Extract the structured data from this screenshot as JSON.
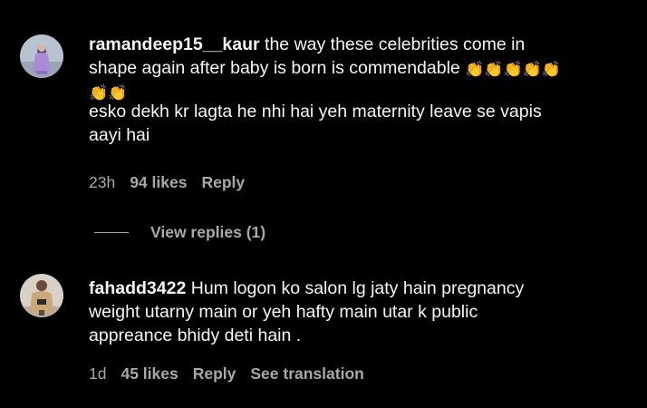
{
  "comments": [
    {
      "username": "ramandeep15__kaur",
      "lines": [
        " the way these celebrities come in",
        "shape again after baby is born is commendable "
      ],
      "emoji_line1": "👏👏👏👏👏",
      "emoji_line2": "👏👏",
      "extra_text": [
        "esko dekh kr lagta he nhi hai yeh maternity leave se vapis",
        "aayi hai"
      ],
      "time": "23h",
      "likes": "94 likes",
      "reply": "Reply",
      "view_replies": "View replies (1)"
    },
    {
      "username": "fahadd3422",
      "lines": [
        " Hum logon ko salon lg jaty hain pregnancy",
        "weight utarny main or yeh hafty main utar k public",
        "appreance bhidy deti hain ."
      ],
      "time": "1d",
      "likes": "45 likes",
      "reply": "Reply",
      "see_translation": "See translation"
    }
  ]
}
